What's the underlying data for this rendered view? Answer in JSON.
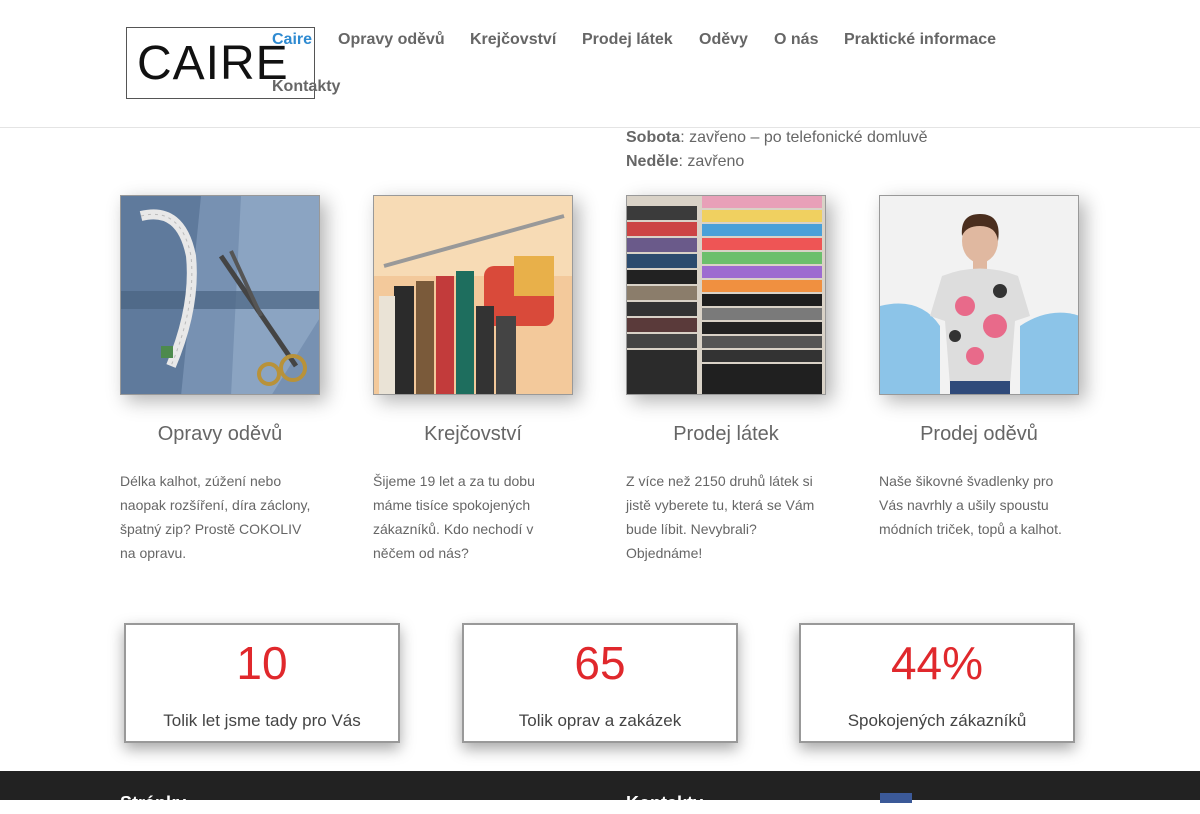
{
  "logo": {
    "text": "CAIRE"
  },
  "nav": {
    "items": [
      {
        "label": "Caire",
        "active": true
      },
      {
        "label": "Opravy oděvů"
      },
      {
        "label": "Krejčovství"
      },
      {
        "label": "Prodej látek"
      },
      {
        "label": "Oděvy"
      },
      {
        "label": "O nás"
      },
      {
        "label": "Praktické informace"
      },
      {
        "label": "Kontakty"
      }
    ],
    "accent": "#2e8ad1"
  },
  "hours": {
    "saturday_label": "Sobota",
    "saturday_value": ": zavřeno – po telefonické domluvě",
    "sunday_label": "Neděle",
    "sunday_value": ": zavřeno"
  },
  "services": [
    {
      "title": "Opravy oděvů",
      "text": "Délka kalhot, zúžení nebo naopak rozšíření, díra záclony, špatný zip? Prostě COKOLIV na opravu.",
      "image_icon": "jeans-scissors-photo"
    },
    {
      "title": "Krejčovství",
      "text": "Šijeme 19 let a za tu dobu máme tisíce spokojených zákazníků. Kdo nechodí v něčem od nás?",
      "image_icon": "clothing-rack-photo"
    },
    {
      "title": "Prodej látek",
      "text": "Z více než 2150 druhů látek si jistě vyberete tu, která se Vám bude líbit. Nevybrali? Objednáme!",
      "image_icon": "fabric-stacks-photo"
    },
    {
      "title": "Prodej oděvů",
      "text": "Naše šikovné švadlenky pro Vás navrhly a ušily spoustu módních triček, topů a kalhot.",
      "image_icon": "woman-top-photo"
    }
  ],
  "counters": [
    {
      "value": "10",
      "label": "Tolik let jsme tady pro Vás"
    },
    {
      "value": "65",
      "label": "Tolik oprav a zakázek"
    },
    {
      "value": "44%",
      "label": "Spokojených zákazníků"
    }
  ],
  "counter_color": "#e0282c",
  "footer": {
    "heading_left": "Stránky",
    "heading_right": "Kontakty",
    "social_icon": "facebook-icon"
  }
}
